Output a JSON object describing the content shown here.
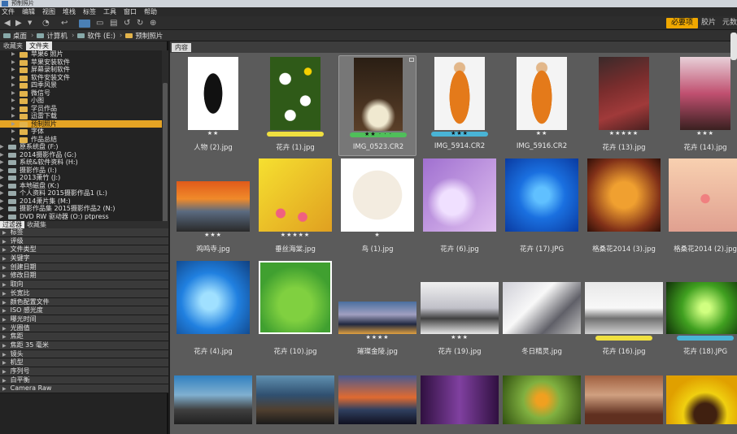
{
  "window": {
    "title": "预制照片"
  },
  "menu": [
    "文件",
    "编辑",
    "视图",
    "堆栈",
    "标签",
    "工具",
    "窗口",
    "帮助"
  ],
  "toolbar": {
    "workspace_active": "必要项",
    "workspace_1": "胶片",
    "workspace_2": "元数"
  },
  "breadcrumb": [
    "桌面",
    "计算机",
    "软件 (E:)",
    "预制照片"
  ],
  "left_panel": {
    "tabs": [
      "收藏夹",
      "文件夹"
    ],
    "tree": [
      {
        "label": "苹果6 照片",
        "type": "folder",
        "indent": 2
      },
      {
        "label": "苹果安装软件",
        "type": "folder",
        "indent": 2
      },
      {
        "label": "屏幕录制软件",
        "type": "folder",
        "indent": 2
      },
      {
        "label": "软件安装文件",
        "type": "folder",
        "indent": 2
      },
      {
        "label": "四季风景",
        "type": "folder",
        "indent": 2
      },
      {
        "label": "微信号",
        "type": "folder",
        "indent": 2
      },
      {
        "label": "小图",
        "type": "folder",
        "indent": 2
      },
      {
        "label": "学员作品",
        "type": "folder",
        "indent": 2
      },
      {
        "label": "迅雷下载",
        "type": "folder",
        "indent": 2
      },
      {
        "label": "预制照片",
        "type": "folder",
        "indent": 2,
        "selected": true
      },
      {
        "label": "字体",
        "type": "folder",
        "indent": 2
      },
      {
        "label": "作品总结",
        "type": "folder",
        "indent": 2
      },
      {
        "label": "原系统盘 (F:)",
        "type": "drive",
        "indent": 1
      },
      {
        "label": "2014摄影作品 (G:)",
        "type": "drive",
        "indent": 1
      },
      {
        "label": "系统&软件资料 (H:)",
        "type": "drive",
        "indent": 1
      },
      {
        "label": "摄影作品 (I:)",
        "type": "drive",
        "indent": 1
      },
      {
        "label": "2013萧竹 (J:)",
        "type": "drive",
        "indent": 1
      },
      {
        "label": "本地磁盘 (K:)",
        "type": "drive",
        "indent": 1
      },
      {
        "label": "个人资料 2015摄影作品1 (L:)",
        "type": "drive",
        "indent": 1
      },
      {
        "label": "2014萧片集 (M:)",
        "type": "drive",
        "indent": 1
      },
      {
        "label": "摄影作品集 2015摄影作品2 (N:)",
        "type": "drive",
        "indent": 1
      },
      {
        "label": "DVD RW 驱动器 (O:) ptpress",
        "type": "drive",
        "indent": 1
      }
    ],
    "filter_tabs": [
      "过滤器",
      "收藏集"
    ],
    "filters": [
      "标签",
      "评级",
      "文件类型",
      "关键字",
      "创建日期",
      "修改日期",
      "取向",
      "长宽比",
      "颜色配置文件",
      "ISO 感光度",
      "曝光时间",
      "光圈值",
      "焦距",
      "焦距 35 毫米",
      "镜头",
      "机型",
      "序列号",
      "白平衡",
      "Camera Raw"
    ]
  },
  "content": {
    "tab": "内容",
    "items": [
      {
        "name": "人物 (2).jpg",
        "stars": "★★",
        "label": "",
        "art": "people"
      },
      {
        "name": "花卉 (1).jpg",
        "stars": "",
        "label": "#f0e040",
        "art": "daisy"
      },
      {
        "name": "IMG_0523.CR2",
        "stars": "★★ · · ·",
        "label": "#4fbf5a",
        "art": "window",
        "selected": true
      },
      {
        "name": "IMG_5914.CR2",
        "stars": "★★★",
        "label": "#49b4d6",
        "art": "coat"
      },
      {
        "name": "IMG_5916.CR2",
        "stars": "★★",
        "label": "",
        "art": "coat"
      },
      {
        "name": "花卉 (13).jpg",
        "stars": "★★★★★",
        "label": "",
        "art": "roof"
      },
      {
        "name": "花卉 (14).jpg",
        "stars": "★★★",
        "label": "",
        "art": "pagoda"
      },
      {
        "name": "鸡鸣寺.jpg",
        "stars": "★★★",
        "label": "",
        "art": "sunset"
      },
      {
        "name": "垂丝海棠.jpg",
        "stars": "★★★★★",
        "label": "",
        "art": "yellow"
      },
      {
        "name": "鸟 (1).jpg",
        "stars": "★",
        "label": "",
        "art": "bird"
      },
      {
        "name": "花卉 (6).jpg",
        "stars": "",
        "label": "",
        "art": "purple"
      },
      {
        "name": "花卉 (17).JPG",
        "stars": "",
        "label": "",
        "art": "blueflower"
      },
      {
        "name": "格桑花2014 (3).jpg",
        "stars": "",
        "label": "",
        "art": "orangeglow"
      },
      {
        "name": "格桑花2014 (2).jpg",
        "stars": "",
        "label": "",
        "art": "pink"
      },
      {
        "name": "花卉 (4).jpg",
        "stars": "",
        "label": "",
        "art": "bluepetal"
      },
      {
        "name": "花卉 (10).jpg",
        "stars": "",
        "label": "",
        "art": "greenleaf"
      },
      {
        "name": "璀璨金陵.jpg",
        "stars": "★★★★",
        "label": "",
        "art": "city"
      },
      {
        "name": "花卉 (19).jpg",
        "stars": "★★★",
        "label": "",
        "art": "snowpavilion"
      },
      {
        "name": "冬日精灵.jpg",
        "stars": "",
        "label": "",
        "art": "frost"
      },
      {
        "name": "花卉 (16).jpg",
        "stars": "",
        "label": "#f0e040",
        "art": "snowbranch"
      },
      {
        "name": "花卉 (18).JPG",
        "stars": "",
        "label": "#49b4d6",
        "art": "greenburst"
      },
      {
        "name": "",
        "stars": "",
        "label": "",
        "art": "coast"
      },
      {
        "name": "",
        "stars": "",
        "label": "",
        "art": "coast2"
      },
      {
        "name": "",
        "stars": "",
        "label": "",
        "art": "sunsetsea"
      },
      {
        "name": "",
        "stars": "",
        "label": "",
        "art": "forest"
      },
      {
        "name": "",
        "stars": "",
        "label": "",
        "art": "insect"
      },
      {
        "name": "",
        "stars": "",
        "label": "",
        "art": "musicians"
      },
      {
        "name": "",
        "stars": "",
        "label": "",
        "art": "sunflower"
      }
    ]
  },
  "colors": {
    "accent": "#e4a324",
    "selected_folder": "#e4a324",
    "content_bg": "#5b5b5b"
  }
}
